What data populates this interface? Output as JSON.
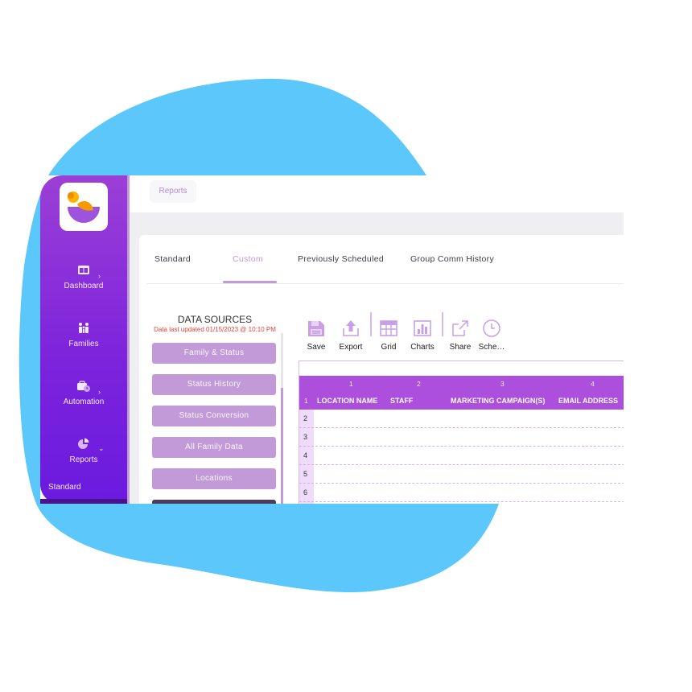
{
  "colors": {
    "backdrop_blob": "#5cc7fa",
    "sidebar_top": "#9b3fd6",
    "sidebar_bottom": "#6a1adf",
    "accent": "#c29ad8",
    "grid_header": "#ab4fdc",
    "updated_text": "#e2453c"
  },
  "sidebar": {
    "logo": "app-logo",
    "items": [
      {
        "label": "Dashboard",
        "icon": "dashboard-icon",
        "chevron": "›"
      },
      {
        "label": "Families",
        "icon": "families-icon",
        "chevron": ""
      },
      {
        "label": "Automation",
        "icon": "automation-icon",
        "chevron": "›"
      },
      {
        "label": "Reports",
        "icon": "reports-icon",
        "chevron": "⌄"
      }
    ],
    "sub_item": "Standard"
  },
  "breadcrumb": {
    "label": "Reports"
  },
  "tabs": [
    {
      "label": "Standard",
      "active": false
    },
    {
      "label": "Custom",
      "active": true
    },
    {
      "label": "Previously Scheduled",
      "active": false
    },
    {
      "label": "Group Comm History",
      "active": false
    }
  ],
  "data_sources": {
    "title": "DATA SOURCES",
    "updated": "Data last updated 01/15/2023 @ 10:10 PM",
    "items": [
      "Family & Status",
      "Status History",
      "Status Conversion",
      "All Family Data",
      "Locations",
      ""
    ]
  },
  "toolbar": {
    "items": [
      {
        "label": "Save",
        "icon": "save-icon"
      },
      {
        "label": "Export",
        "icon": "export-icon"
      },
      {
        "label": "Grid",
        "icon": "grid-icon"
      },
      {
        "label": "Charts",
        "icon": "charts-icon"
      },
      {
        "label": "Share",
        "icon": "share-icon"
      },
      {
        "label": "Sche…",
        "icon": "schedule-icon"
      }
    ]
  },
  "grid": {
    "column_numbers": [
      "1",
      "2",
      "3",
      "4"
    ],
    "header_row_number": "1",
    "headers": [
      "LOCATION NAME",
      "STAFF",
      "MARKETING CAMPAIGN(S)",
      "EMAIL ADDRESS"
    ],
    "row_numbers": [
      "2",
      "3",
      "4",
      "5",
      "6"
    ]
  }
}
